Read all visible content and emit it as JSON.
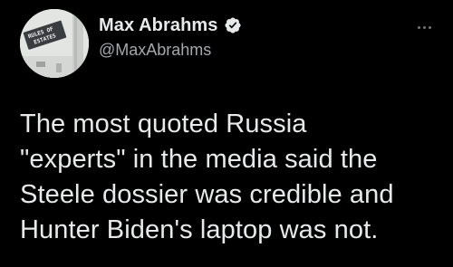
{
  "author": {
    "display_name": "Max Abrahms",
    "handle": "@MaxAbrahms",
    "verified": true,
    "avatar_sign_text": [
      "RULES OF",
      "ESTATES"
    ]
  },
  "tweet": {
    "lines": [
      "The most quoted Russia",
      "\"experts\" in the media said the",
      "Steele dossier was credible and",
      "Hunter Biden's laptop was not."
    ]
  },
  "icons": {
    "verified": "verified-badge-icon",
    "more": "more-options-icon"
  },
  "colors": {
    "background": "#000000",
    "text_primary": "#e7e9ea",
    "text_secondary": "#a3a8ad",
    "icon_muted": "#71767b"
  }
}
